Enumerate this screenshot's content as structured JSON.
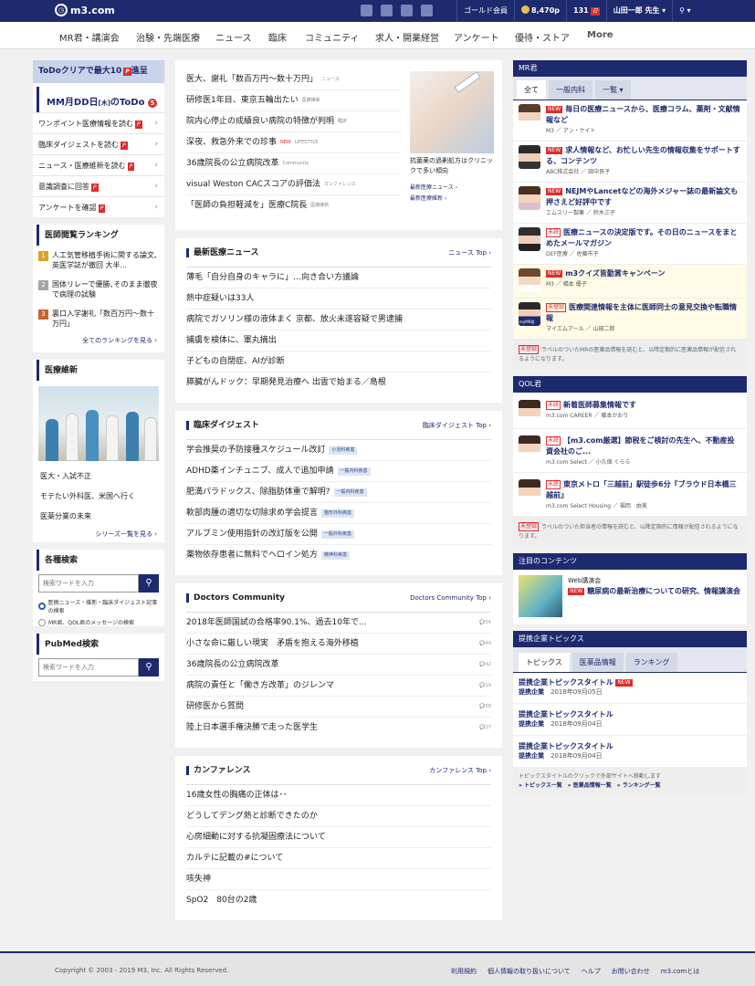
{
  "topbar": {
    "logo": "m3.com",
    "membership": "ゴールド会員",
    "points": "8,470p",
    "notifications": "131",
    "user": "山田一郎 先生",
    "colors": {
      "brand": "#1e2a6e",
      "accent_red": "#e02b2b"
    }
  },
  "nav": [
    "MR君・講演会",
    "治験・先端医療",
    "ニュース",
    "臨床",
    "コミュニティ",
    "求人・開業経営",
    "アンケート",
    "優待・ストア",
    "More"
  ],
  "todo": {
    "header": "ToDoクリアで最大10",
    "header_suffix": "進呈",
    "title": "MM月DD日",
    "title_day": "[木]",
    "title_suffix": "のToDo",
    "count": "5",
    "items": [
      "ワンポイント医療情報を読む",
      "臨床ダイジェストを読む",
      "ニュース・医療維新を読む",
      "意識調査に回答",
      "アンケートを確認"
    ]
  },
  "ranking": {
    "title": "医師閲覧ランキング",
    "items": [
      {
        "num": "1",
        "text": "人工気管移植手術に関する論文､英医学誌が撤回 大半..."
      },
      {
        "num": "2",
        "text": "国体リレーで優勝､そのまま徹夜で病理の試験"
      },
      {
        "num": "3",
        "text": "裏口入学謝礼「数百万円～数十万円」"
      }
    ],
    "more": "全てのランキングを見る"
  },
  "ishin": {
    "title": "医療維新",
    "links": [
      "医大・入試不正",
      "モテたい外科医、米国へ行く",
      "医薬分業の未来"
    ],
    "more": "シリーズ一覧を見る"
  },
  "search": {
    "title": "各種検索",
    "placeholder": "検索ワードを入力",
    "options": [
      "医療ニュース・維新・臨床ダイジェスト記事の検索",
      "MR君、QOL君のメッセージの検索"
    ]
  },
  "pubmed": {
    "title": "PubMed検索",
    "placeholder": "検索ワードを入力"
  },
  "top_news": {
    "items": [
      {
        "text": "医大、謝礼「数百万円～数十万円」",
        "tag": "ニュース"
      },
      {
        "text": "研修医1年目、東京五輪出たい",
        "tag": "医療維新"
      },
      {
        "text": "院内心停止の成績良い病院の特徴が判明",
        "tag": "臨床"
      },
      {
        "text": "深夜、救急外来での珍事",
        "tag": "LIFESTYLE",
        "new": "NEW"
      },
      {
        "text": "36歳院長の公立病院改革",
        "tag": "Community"
      },
      {
        "text": "visual Weston CACスコアの評価法",
        "tag": "カンファレンス"
      },
      {
        "text": "「医師の負担軽減を」医療C院長",
        "tag": "医療維新"
      }
    ],
    "feature_caption": "抗菌薬の過剰処方はクリニックで多い傾向",
    "feature_links": [
      "最新医療ニュース",
      "最新医療維新"
    ]
  },
  "news": {
    "title": "最新医療ニュース",
    "link": "ニュース Top",
    "items": [
      "薄毛「自分自身のキャラに」…向き合い方議論",
      "熱中症疑いは33人",
      "病院でガソリン様の液体まく 京都、放火未遂容疑で男逮捕",
      "捕虜を検体に、軍丸摘出",
      "子どもの自閉症、AIが診断",
      "膵臓がんドック：早期発見治療へ 出雲で始まる／島根"
    ]
  },
  "digest": {
    "title": "臨床ダイジェスト",
    "link": "臨床ダイジェスト Top",
    "items": [
      {
        "text": "学会推奨の予防接種スケジュール改訂",
        "tag": "小児科疾患"
      },
      {
        "text": "ADHD薬インチュニブ、成人で追加申請",
        "tag": "一般内科疾患"
      },
      {
        "text": "肥満パラドックス、除脂肪体重で解明?",
        "tag": "一般内科疾患"
      },
      {
        "text": "軟部肉腫の適切な切除求め学会提言",
        "tag": "整形外科疾患"
      },
      {
        "text": "アルブミン使用指針の改訂版を公開",
        "tag": "一般外科疾患"
      },
      {
        "text": "薬物依存患者に無料でヘロイン処方",
        "tag": "精神科疾患"
      }
    ]
  },
  "community": {
    "title": "Doctors Community",
    "link": "Doctors Community Top",
    "items": [
      {
        "text": "2018年医師国試の合格率90.1%、過去10年で...",
        "count": "54"
      },
      {
        "text": "小さな命に厳しい現実　矛盾を抱える海外移植",
        "count": "49"
      },
      {
        "text": "36歳院長の公立病院改革",
        "count": "62"
      },
      {
        "text": "病院の責任と「働き方改革」のジレンマ",
        "count": "19"
      },
      {
        "text": "研修医から質問",
        "count": "58"
      },
      {
        "text": "陸上日本選手権決勝で走った医学生",
        "count": "27"
      }
    ]
  },
  "conference": {
    "title": "カンファレンス",
    "link": "カンファレンス Top",
    "items": [
      "16歳女性の胸痛の正体は･･",
      "どうしてデング熱と診断できたのか",
      "心房細動に対する抗凝固療法について",
      "カルテに記載の#について",
      "咳失神",
      "SpO2　80台の2歳"
    ]
  },
  "mr": {
    "title": "MR君",
    "tabs": [
      "全て",
      "一般内科",
      "一覧"
    ],
    "items": [
      {
        "badge": "NEW",
        "title": "毎日の医療ニュースから、医療コラム、薬剤・文献情報など",
        "sub": "M3 ／ アン・ケイト"
      },
      {
        "badge": "NEW",
        "title": "求人情報など、お忙しい先生の情報収集をサポートする、コンテンツ",
        "sub": "ABC株式会社 ／ 田中良子"
      },
      {
        "badge": "NEW",
        "title": "NEJMやLancetなどの海外メジャー誌の最新論文も押さえど好評中です",
        "sub": "エムスリー製薬 ／ 鈴木三子"
      },
      {
        "badge": "未読",
        "title": "医療ニュースの決定版です。その日のニュースをまとめたメールマガジン",
        "sub": "DEF医療 ／ 佐藤市子"
      },
      {
        "badge": "NEW",
        "title": "m3クイズ皆勤賞キャンペーン",
        "sub": "M3 ／ 橋本 優子"
      },
      {
        "badge": "未登録",
        "title": "医療関連情報を主体に医師同士の意見交換や転職情報",
        "sub": "マイエムアール ／ 山田二郎",
        "avatar_label": "myMR君"
      }
    ],
    "note_badge": "未登録",
    "note": "ラベルのついたMRの医薬品情報を読むと、以降定期的に医薬品情報が配信されるようになります。"
  },
  "qol": {
    "title": "QOL君",
    "items": [
      {
        "badge": "未読",
        "title": "新着医師募集情報です",
        "sub": "m3.com CAREER ／ 藤本かおり"
      },
      {
        "badge": "未読",
        "title": "【m3.com厳選】節税をご検討の先生へ、不動産投資会社のご...",
        "sub": "m3.com Select ／ 小久保 くらら"
      },
      {
        "badge": "未読",
        "title": "東京メトロ「三越前」駅徒歩6分『ブラウド日本橋三越前』",
        "sub": "m3.com Select Housing ／ 福岡　由美"
      }
    ],
    "note_badge": "未登録",
    "note": "ラベルのついた担当者の情報を読むと、以降定期的に情報が配信されるようになります。"
  },
  "attention": {
    "title": "注目のコンテンツ",
    "label": "Web講演会",
    "badge": "NEW",
    "text": "糖尿病の最新治療についての研究、情報講演会"
  },
  "topics": {
    "title": "提携企業トピックス",
    "tabs": [
      "トピックス",
      "医薬品情報",
      "ランキング"
    ],
    "items": [
      {
        "title": "提携企業トピックスタイトル",
        "new": "NEW",
        "src": "提携企業",
        "date": "2018年09月05日"
      },
      {
        "title": "提携企業トピックスタイトル",
        "src": "提携企業",
        "date": "2018年09月04日"
      },
      {
        "title": "提携企業トピックスタイトル",
        "src": "提携企業",
        "date": "2018年09月04日"
      }
    ],
    "note": "トピックスタイトルのクリックで外部サイトへ移動します",
    "links": [
      "» トピックス一覧",
      "» 医薬品情報一覧",
      "» ランキング一覧"
    ]
  },
  "footer": {
    "copyright": "Copyright © 2003 - 2019 M3, Inc. All Rights Reserved.",
    "links": [
      "利用規約",
      "個人情報の取り扱いについて",
      "ヘルプ",
      "お問い合わせ",
      "m3.comとは"
    ]
  }
}
